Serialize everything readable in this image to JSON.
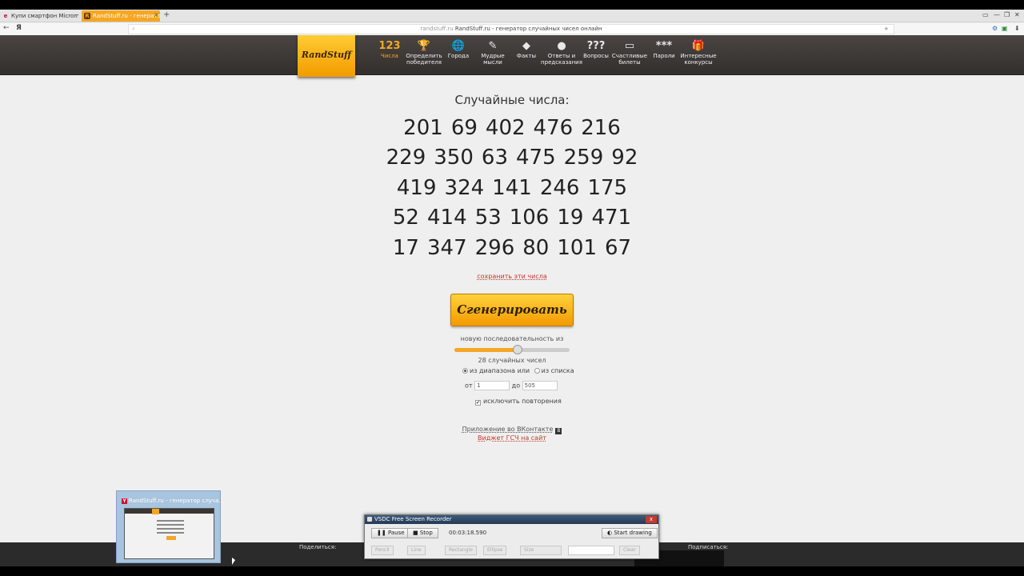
{
  "browser": {
    "tabs": [
      {
        "label": "Купи смартфон Micromax",
        "favicon": "e"
      },
      {
        "label": "RandStuff.ru - генератор сл",
        "favicon": "R"
      }
    ],
    "tab_close_glyph": "×",
    "new_tab_glyph": "+",
    "back_glyph": "←",
    "home_glyph": "Я",
    "address_host": "randstuff.ru",
    "address_title": "RandStuff.ru - генератор случайных чисел онлайн",
    "window_controls": [
      "▭",
      "—",
      "❐",
      "✕"
    ]
  },
  "site": {
    "logo": "RandStuff",
    "nav": [
      {
        "icon": "123",
        "label": "Числа",
        "active": true
      },
      {
        "icon": "🏆",
        "label": "Определить победителя"
      },
      {
        "icon": "🌐",
        "label": "Города"
      },
      {
        "icon": "✎",
        "label": "Мудрые мысли"
      },
      {
        "icon": "◆",
        "label": "Факты"
      },
      {
        "icon": "●",
        "label": "Ответы и предсказания"
      },
      {
        "icon": "???",
        "label": "Вопросы"
      },
      {
        "icon": "▭",
        "label": "Счастливые билеты"
      },
      {
        "icon": "***",
        "label": "Пароли"
      },
      {
        "icon": "🎁",
        "label": "Интересные конкурсы"
      }
    ]
  },
  "content": {
    "heading": "Случайные числа:",
    "rows": [
      [
        "201",
        "69",
        "402",
        "476",
        "216"
      ],
      [
        "229",
        "350",
        "63",
        "475",
        "259",
        "92"
      ],
      [
        "419",
        "324",
        "141",
        "246",
        "175"
      ],
      [
        "52",
        "414",
        "53",
        "106",
        "19",
        "471"
      ],
      [
        "17",
        "347",
        "296",
        "80",
        "101",
        "67"
      ]
    ],
    "save_link": "сохранить эти числа",
    "generate_button": "Сгенерировать",
    "sequence_label": "новую последовательность из",
    "slider_fraction": 0.55,
    "count_label": "28 случайных чисел",
    "radio_range": "из диапазона или",
    "radio_list": "из списка",
    "from_label": "от",
    "from_value": "1",
    "to_label": "до",
    "to_value": "505",
    "exclude_repeats": "исключить повторения",
    "vk_link": "Приложение во ВКонтакте",
    "vk_icon": "В",
    "widget_link": "Виджет ГСЧ на сайт"
  },
  "taskbar": {
    "share_left": "Поделиться:",
    "share_right": "Подписаться:",
    "preview_title": "RandStuff.ru - генератор случа..."
  },
  "recorder": {
    "title": "VSDC Free Screen Recorder",
    "close": "x",
    "pause": "Pause",
    "stop": "Stop",
    "time": "00:03:18.590",
    "start_drawing": "Start drawing",
    "tools": [
      "Pencil",
      "Line",
      "Rectangle",
      "Ellipse",
      "Size",
      "",
      "Clear"
    ]
  },
  "colors": {
    "accent": "#f5a623",
    "header_bg": "#3d3936",
    "link_red": "#c0392b"
  }
}
